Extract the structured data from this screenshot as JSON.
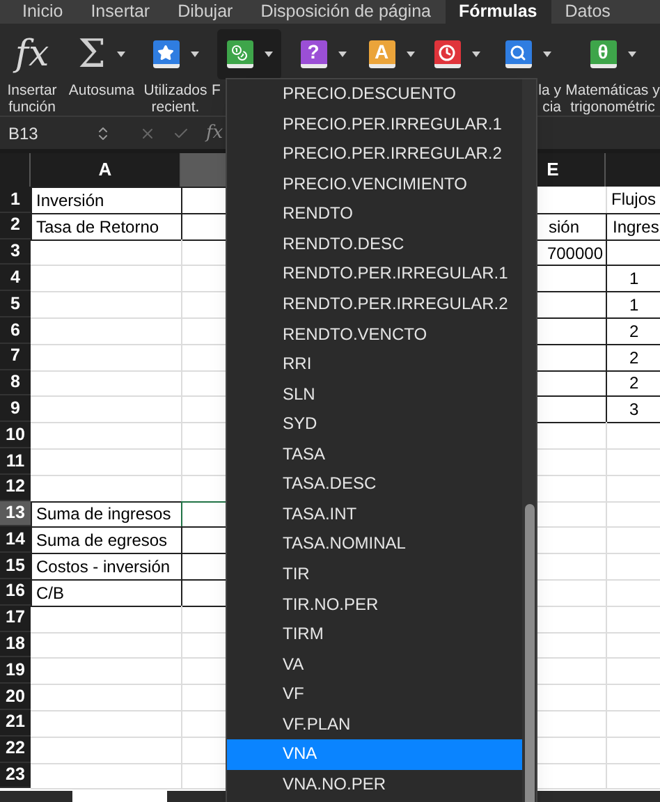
{
  "tabs": [
    {
      "label": "Inicio",
      "selected": false
    },
    {
      "label": "Insertar",
      "selected": false
    },
    {
      "label": "Dibujar",
      "selected": false
    },
    {
      "label": "Disposición de página",
      "selected": false
    },
    {
      "label": "Fórmulas",
      "selected": true
    },
    {
      "label": "Datos",
      "selected": false
    }
  ],
  "ribbon": [
    {
      "kind": "fx",
      "glyph": "fx",
      "label": [
        "Insertar",
        "función"
      ],
      "pressed": false
    },
    {
      "kind": "sum",
      "glyph": "Σ",
      "label": [
        "Autosuma"
      ],
      "pressed": false
    },
    {
      "kind": "star",
      "color": "#2f7de1",
      "label": [
        "Utilizados",
        "recient."
      ],
      "pressed": false
    },
    {
      "kind": "coins",
      "color": "#3ea54a",
      "label": [
        "F"
      ],
      "pressed": true
    },
    {
      "kind": "glyph",
      "glyph": "?",
      "color": "#9b4fd6",
      "pressed": false
    },
    {
      "kind": "glyph",
      "glyph": "A",
      "color": "#eba43a",
      "pressed": false
    },
    {
      "kind": "clock",
      "color": "#e0343b",
      "pressed": false
    },
    {
      "kind": "search",
      "color": "#2f7de1",
      "label": [
        "la y",
        "cia"
      ],
      "pressed": false
    },
    {
      "kind": "glyph",
      "glyph": "θ",
      "color": "#3ea54a",
      "label": [
        "Matemáticas y",
        "trigonométric"
      ],
      "pressed": false
    }
  ],
  "formula_bar": {
    "name_box": "B13",
    "fx": "fx"
  },
  "grid": {
    "columns": [
      {
        "label": "A",
        "selected": false
      },
      {
        "selected": true
      },
      {
        "label": "E",
        "selected": false
      }
    ],
    "rows": [
      {
        "number": "1",
        "selected": false,
        "a": "Inversión",
        "f": "Flujos"
      },
      {
        "number": "2",
        "selected": false,
        "a": "Tasa de Retorno",
        "e": "sión",
        "f": "Ingres"
      },
      {
        "number": "3",
        "selected": false,
        "e": "700000"
      },
      {
        "number": "4",
        "selected": false,
        "f": "1"
      },
      {
        "number": "5",
        "selected": false,
        "f": "1"
      },
      {
        "number": "6",
        "selected": false,
        "f": "2"
      },
      {
        "number": "7",
        "selected": false,
        "f": "2"
      },
      {
        "number": "8",
        "selected": false,
        "f": "2"
      },
      {
        "number": "9",
        "selected": false,
        "f": "3"
      },
      {
        "number": "10",
        "selected": false
      },
      {
        "number": "11",
        "selected": false
      },
      {
        "number": "12",
        "selected": false
      },
      {
        "number": "13",
        "selected": true,
        "a": "Suma de ingresos"
      },
      {
        "number": "14",
        "selected": false,
        "a": "Suma de egresos"
      },
      {
        "number": "15",
        "selected": false,
        "a": "Costos - inversión"
      },
      {
        "number": "16",
        "selected": false,
        "a": "C/B"
      },
      {
        "number": "17",
        "selected": false
      },
      {
        "number": "18",
        "selected": false
      },
      {
        "number": "19",
        "selected": false
      },
      {
        "number": "20",
        "selected": false
      },
      {
        "number": "21",
        "selected": false
      },
      {
        "number": "22",
        "selected": false
      },
      {
        "number": "23",
        "selected": false
      }
    ]
  },
  "menu": {
    "items": [
      {
        "label": "PRECIO.DESCUENTO",
        "selected": false
      },
      {
        "label": "PRECIO.PER.IRREGULAR.1",
        "selected": false
      },
      {
        "label": "PRECIO.PER.IRREGULAR.2",
        "selected": false
      },
      {
        "label": "PRECIO.VENCIMIENTO",
        "selected": false
      },
      {
        "label": "RENDTO",
        "selected": false
      },
      {
        "label": "RENDTO.DESC",
        "selected": false
      },
      {
        "label": "RENDTO.PER.IRREGULAR.1",
        "selected": false
      },
      {
        "label": "RENDTO.PER.IRREGULAR.2",
        "selected": false
      },
      {
        "label": "RENDTO.VENCTO",
        "selected": false
      },
      {
        "label": "RRI",
        "selected": false
      },
      {
        "label": "SLN",
        "selected": false
      },
      {
        "label": "SYD",
        "selected": false
      },
      {
        "label": "TASA",
        "selected": false
      },
      {
        "label": "TASA.DESC",
        "selected": false
      },
      {
        "label": "TASA.INT",
        "selected": false
      },
      {
        "label": "TASA.NOMINAL",
        "selected": false
      },
      {
        "label": "TIR",
        "selected": false
      },
      {
        "label": "TIR.NO.PER",
        "selected": false
      },
      {
        "label": "TIRM",
        "selected": false
      },
      {
        "label": "VA",
        "selected": false
      },
      {
        "label": "VF",
        "selected": false
      },
      {
        "label": "VF.PLAN",
        "selected": false
      },
      {
        "label": "VNA",
        "selected": true
      },
      {
        "label": "VNA.NO.PER",
        "selected": false
      }
    ]
  }
}
